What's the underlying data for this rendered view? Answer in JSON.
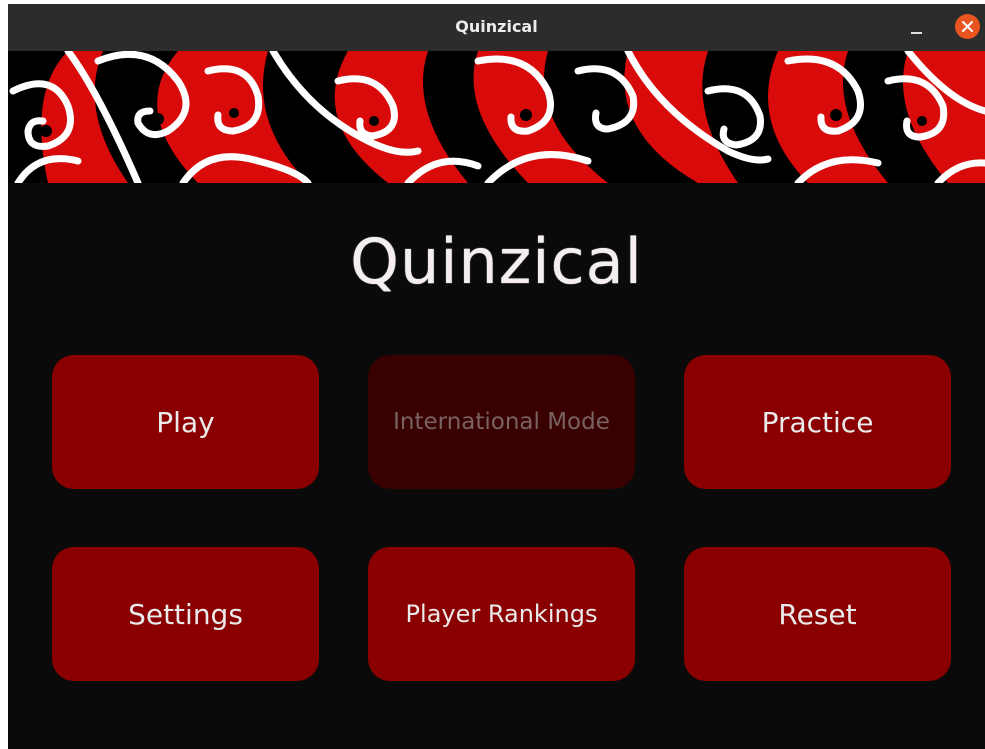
{
  "window": {
    "title": "Quinzical",
    "controls": [
      "minimize-icon",
      "close-icon"
    ],
    "close_color": "#e9541f"
  },
  "banner": {
    "pattern": "maori-kowhaiwhai-pattern",
    "colors": [
      "#d80a0a",
      "#000000",
      "#ffffff"
    ]
  },
  "app": {
    "title": "Quinzical"
  },
  "menu": {
    "play": "Play",
    "international": "International Mode",
    "practice": "Practice",
    "settings": "Settings",
    "rankings": "Player Rankings",
    "reset": "Reset"
  },
  "colors": {
    "background": "#0a0a0a",
    "button": "#8a0000",
    "button_disabled": "#380000"
  }
}
